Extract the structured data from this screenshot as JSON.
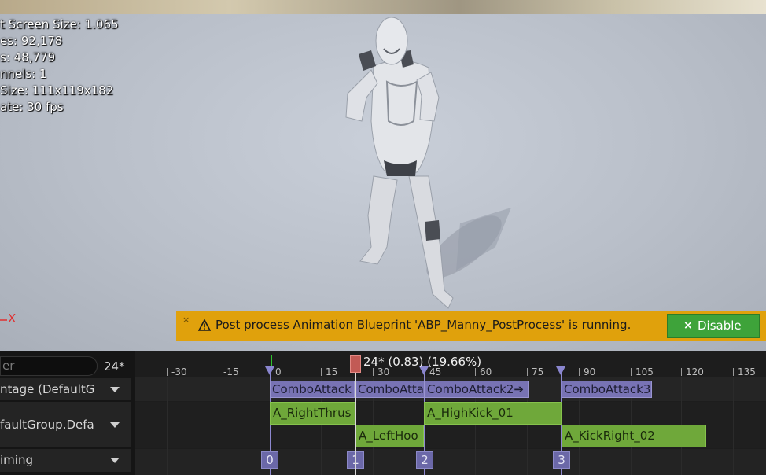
{
  "viewport": {
    "stats": [
      "t Screen Size: 1.065",
      "es: 92,178",
      "s: 48,779",
      "nnels: 1",
      "Size: 111x119x182",
      "ate: 30 fps"
    ],
    "axis_label": "X"
  },
  "notification": {
    "close_label": "×",
    "message": "Post process Animation Blueprint 'ABP_Manny_PostProcess' is running.",
    "button_label": "Disable",
    "button_icon": "×"
  },
  "tracks": {
    "filter_placeholder": "er",
    "frame_count": "24*",
    "rows": [
      "ntage (DefaultG",
      "faultGroup.Defa",
      "iming"
    ]
  },
  "timeline": {
    "ticks": [
      "-30",
      "-15",
      "0",
      "15",
      "30",
      "45",
      "60",
      "75",
      "90",
      "105",
      "120",
      "135"
    ],
    "scrubber_label": "24* (0.83) (19.66%)",
    "sections": [
      "ComboAttack",
      "ComboAtta",
      "ComboAttack2➔",
      "ComboAttack3"
    ],
    "segments": [
      "A_RightThrus",
      "A_HighKick_01",
      "A_LeftHoo",
      "A_KickRight_02"
    ],
    "notifies": [
      "0",
      "1",
      "2",
      "3"
    ]
  },
  "colors": {
    "notification_bg": "#e0a10c",
    "disable_button": "#3ea33a",
    "section_purple": "#7873b4",
    "segment_green": "#6fa83a",
    "scrubber_red": "#c25a55"
  }
}
